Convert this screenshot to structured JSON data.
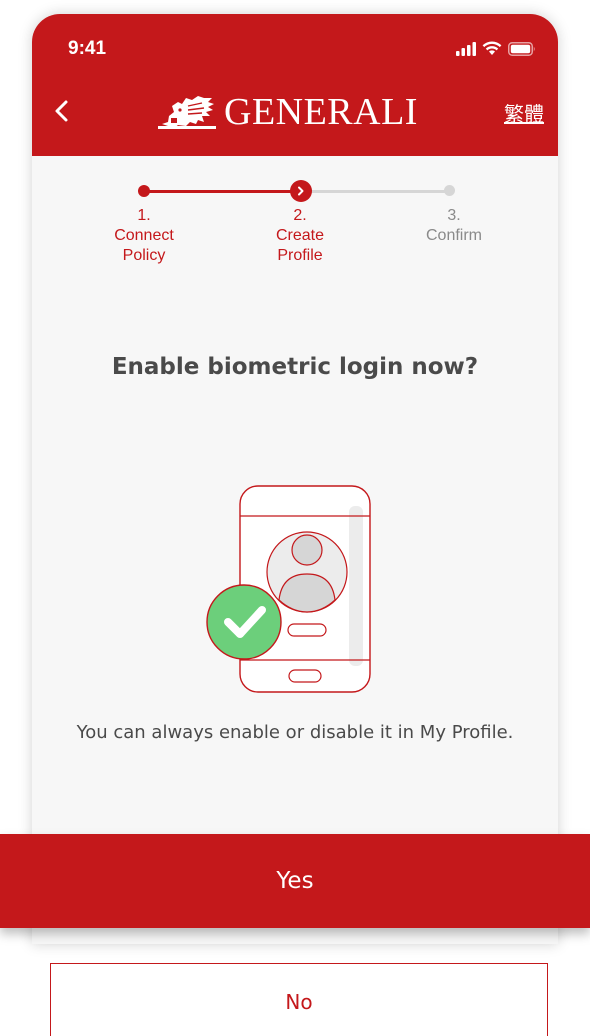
{
  "status": {
    "time": "9:41"
  },
  "header": {
    "logo_text": "GENERALI",
    "lang_label": "繁體"
  },
  "stepper": {
    "steps": [
      {
        "number": "1.",
        "label_line1": "Connect",
        "label_line2": "Policy",
        "state": "done"
      },
      {
        "number": "2.",
        "label_line1": "Create",
        "label_line2": "Profile",
        "state": "current"
      },
      {
        "number": "3.",
        "label_line1": "Confirm",
        "label_line2": "",
        "state": "upcoming"
      }
    ]
  },
  "content": {
    "title": "Enable biometric login now?",
    "hint": "You can always enable or disable it in My Profile."
  },
  "actions": {
    "yes_label": "Yes",
    "no_label": "No"
  },
  "colors": {
    "brand_red": "#c4181b",
    "inactive_gray": "#d0d0d0",
    "check_green": "#6ccf7b"
  },
  "icons": [
    "back-chevron-icon",
    "generali-lion-logo",
    "signal-icon",
    "wifi-icon",
    "battery-icon",
    "chevron-right-icon",
    "biometric-phone-illustration",
    "checkmark-icon"
  ]
}
